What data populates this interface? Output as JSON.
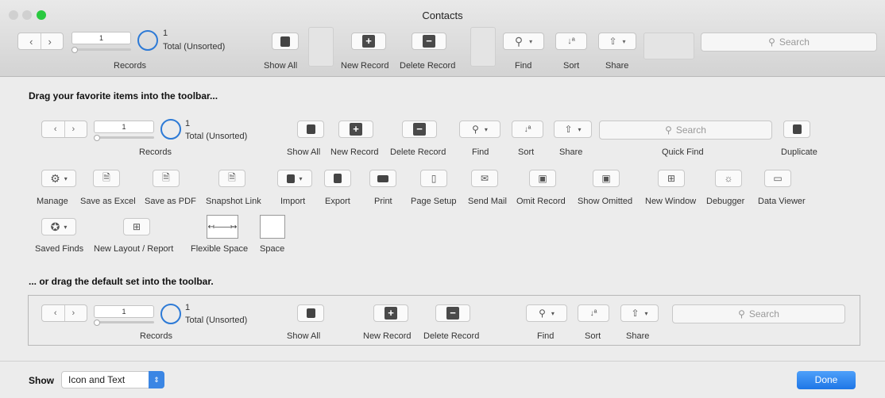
{
  "window": {
    "title": "Contacts"
  },
  "toolbar": {
    "record_value": "1",
    "records_count": "1",
    "records_status": "Total (Unsorted)",
    "records_label": "Records",
    "show_all": "Show All",
    "new_record": "New Record",
    "delete_record": "Delete Record",
    "find": "Find",
    "sort": "Sort",
    "share": "Share",
    "search_placeholder": "Search"
  },
  "palette": {
    "heading": "Drag your favorite items into the toolbar...",
    "row1": {
      "records_value": "1",
      "records_count": "1",
      "records_status": "Total (Unsorted)",
      "records_label": "Records",
      "show_all": "Show All",
      "new_record": "New Record",
      "delete_record": "Delete Record",
      "find": "Find",
      "sort": "Sort",
      "share": "Share",
      "search_placeholder": "Search",
      "quick_find": "Quick Find",
      "duplicate": "Duplicate"
    },
    "row2": [
      "Manage",
      "Save as Excel",
      "Save as PDF",
      "Snapshot Link",
      "Import",
      "Export",
      "Print",
      "Page Setup",
      "Send Mail",
      "Omit Record",
      "Show Omitted",
      "New Window",
      "Debugger",
      "Data Viewer"
    ],
    "row3": [
      "Saved Finds",
      "New Layout / Report",
      "Flexible Space",
      "Space"
    ]
  },
  "defaults": {
    "heading": "... or drag the default set into the toolbar.",
    "records_value": "1",
    "records_count": "1",
    "records_status": "Total (Unsorted)",
    "records_label": "Records",
    "show_all": "Show All",
    "new_record": "New Record",
    "delete_record": "Delete Record",
    "find": "Find",
    "sort": "Sort",
    "share": "Share",
    "search_placeholder": "Search"
  },
  "footer": {
    "show_label": "Show",
    "show_value": "Icon and Text",
    "done": "Done"
  },
  "colors": {
    "accent": "#1e76e6",
    "circle": "#2d7ad6"
  }
}
